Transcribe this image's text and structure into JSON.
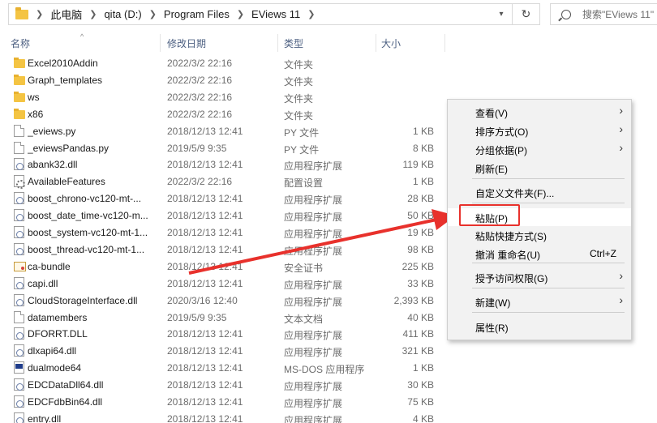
{
  "address_bar": {
    "breadcrumbs": [
      "此电脑",
      "qita (D:)",
      "Program Files",
      "EViews 11"
    ],
    "search_placeholder": "搜索\"EViews 11\""
  },
  "columns": {
    "name": "名称",
    "date": "修改日期",
    "type": "类型",
    "size": "大小"
  },
  "files": [
    {
      "name": "Excel2010Addin",
      "date": "2022/3/2 22:16",
      "type": "文件夹",
      "size": "",
      "icon": "folder-icon"
    },
    {
      "name": "Graph_templates",
      "date": "2022/3/2 22:16",
      "type": "文件夹",
      "size": "",
      "icon": "folder-icon"
    },
    {
      "name": "ws",
      "date": "2022/3/2 22:16",
      "type": "文件夹",
      "size": "",
      "icon": "folder-icon"
    },
    {
      "name": "x86",
      "date": "2022/3/2 22:16",
      "type": "文件夹",
      "size": "",
      "icon": "folder-icon"
    },
    {
      "name": "_eviews.py",
      "date": "2018/12/13 12:41",
      "type": "PY 文件",
      "size": "1 KB",
      "icon": "file-icon"
    },
    {
      "name": "_eviewsPandas.py",
      "date": "2019/5/9 9:35",
      "type": "PY 文件",
      "size": "8 KB",
      "icon": "file-icon"
    },
    {
      "name": "abank32.dll",
      "date": "2018/12/13 12:41",
      "type": "应用程序扩展",
      "size": "119 KB",
      "icon": "dll-icon"
    },
    {
      "name": "AvailableFeatures",
      "date": "2022/3/2 22:16",
      "type": "配置设置",
      "size": "1 KB",
      "icon": "settings-file-icon"
    },
    {
      "name": "boost_chrono-vc120-mt-...",
      "date": "2018/12/13 12:41",
      "type": "应用程序扩展",
      "size": "28 KB",
      "icon": "dll-icon"
    },
    {
      "name": "boost_date_time-vc120-m...",
      "date": "2018/12/13 12:41",
      "type": "应用程序扩展",
      "size": "50 KB",
      "icon": "dll-icon"
    },
    {
      "name": "boost_system-vc120-mt-1...",
      "date": "2018/12/13 12:41",
      "type": "应用程序扩展",
      "size": "19 KB",
      "icon": "dll-icon"
    },
    {
      "name": "boost_thread-vc120-mt-1...",
      "date": "2018/12/13 12:41",
      "type": "应用程序扩展",
      "size": "98 KB",
      "icon": "dll-icon"
    },
    {
      "name": "ca-bundle",
      "date": "2018/12/13 12:41",
      "type": "安全证书",
      "size": "225 KB",
      "icon": "certificate-icon"
    },
    {
      "name": "capi.dll",
      "date": "2018/12/13 12:41",
      "type": "应用程序扩展",
      "size": "33 KB",
      "icon": "dll-icon"
    },
    {
      "name": "CloudStorageInterface.dll",
      "date": "2020/3/16 12:40",
      "type": "应用程序扩展",
      "size": "2,393 KB",
      "icon": "dll-icon"
    },
    {
      "name": "datamembers",
      "date": "2019/5/9 9:35",
      "type": "文本文档",
      "size": "40 KB",
      "icon": "file-icon"
    },
    {
      "name": "DFORRT.DLL",
      "date": "2018/12/13 12:41",
      "type": "应用程序扩展",
      "size": "411 KB",
      "icon": "dll-icon"
    },
    {
      "name": "dlxapi64.dll",
      "date": "2018/12/13 12:41",
      "type": "应用程序扩展",
      "size": "321 KB",
      "icon": "dll-icon"
    },
    {
      "name": "dualmode64",
      "date": "2018/12/13 12:41",
      "type": "MS-DOS 应用程序",
      "size": "1 KB",
      "icon": "msdos-icon"
    },
    {
      "name": "EDCDataDll64.dll",
      "date": "2018/12/13 12:41",
      "type": "应用程序扩展",
      "size": "30 KB",
      "icon": "dll-icon"
    },
    {
      "name": "EDCFdbBin64.dll",
      "date": "2018/12/13 12:41",
      "type": "应用程序扩展",
      "size": "75 KB",
      "icon": "dll-icon"
    },
    {
      "name": "entry.dll",
      "date": "2018/12/13 12:41",
      "type": "应用程序扩展",
      "size": "4 KB",
      "icon": "dll-icon"
    }
  ],
  "context_menu": {
    "items": [
      {
        "label": "查看(V)",
        "submenu": true
      },
      {
        "label": "排序方式(O)",
        "submenu": true
      },
      {
        "label": "分组依据(P)",
        "submenu": true
      },
      {
        "label": "刷新(E)",
        "submenu": false
      },
      {
        "label": "自定义文件夹(F)...",
        "submenu": false
      },
      {
        "label": "粘贴(P)",
        "submenu": false,
        "highlighted": true
      },
      {
        "label": "粘贴快捷方式(S)",
        "submenu": false
      },
      {
        "label": "撤消 重命名(U)",
        "submenu": false,
        "shortcut": "Ctrl+Z"
      },
      {
        "label": "授予访问权限(G)",
        "submenu": true
      },
      {
        "label": "新建(W)",
        "submenu": true
      },
      {
        "label": "属性(R)",
        "submenu": false
      }
    ]
  },
  "annotation_color": "#e8312c"
}
